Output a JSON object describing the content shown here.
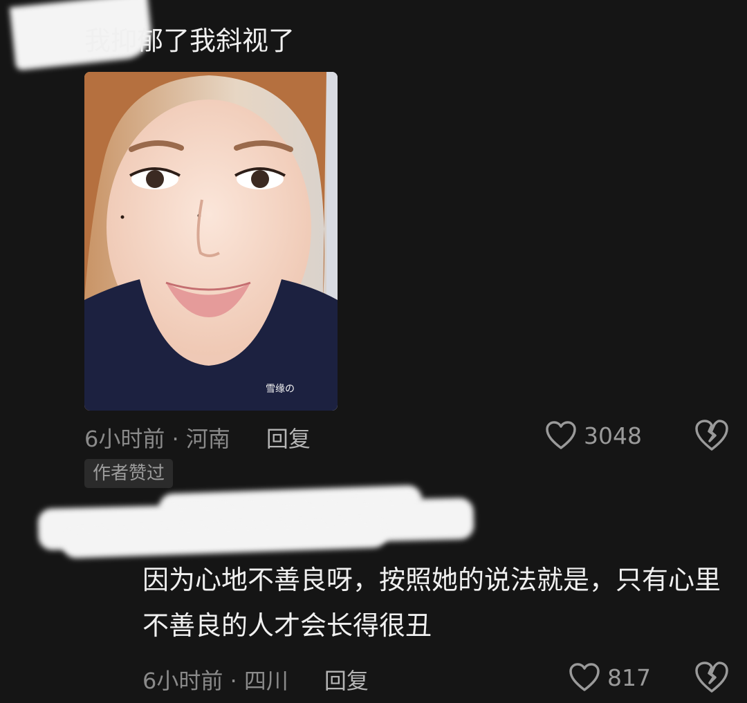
{
  "comments": [
    {
      "text": "我抑郁了我斜视了",
      "image_watermark": "雪缘の",
      "time_location": "6小时前 · 河南",
      "reply_label": "回复",
      "likes": "3048",
      "badge": "作者赞过"
    },
    {
      "text": "因为心地不善良呀，按照她的说法就是，只有心里不善良的人才会长得很丑",
      "time_location": "6小时前 · 四川",
      "reply_label": "回复",
      "likes": "817"
    }
  ],
  "colors": {
    "background": "#151515",
    "text": "#f0f0f0",
    "meta": "#8a8a8a",
    "badge_bg": "#2b2b2b"
  },
  "icons": {
    "like": "heart-outline-icon",
    "dislike": "broken-heart-icon"
  }
}
